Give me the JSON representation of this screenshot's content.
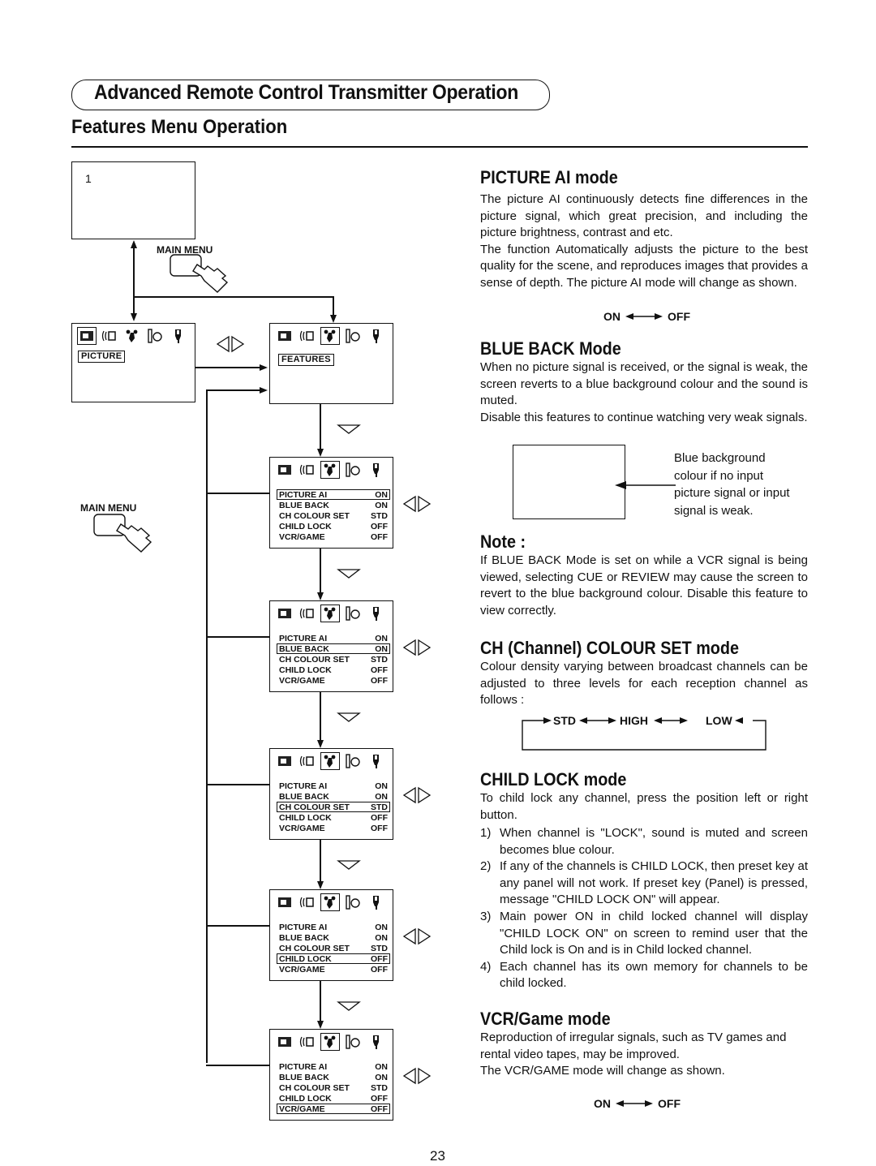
{
  "header": {
    "title": "Advanced Remote Control Transmitter Operation",
    "subtitle": "Features Menu Operation"
  },
  "diagram": {
    "channel_number": "1",
    "main_menu_label": "MAIN MENU",
    "main_menu_label_2": "MAIN MENU",
    "tabs": {
      "picture": "PICTURE",
      "features": "FEATURES"
    },
    "menu_icons": [
      "picture-icon",
      "sound-icon",
      "features-icon",
      "timer-icon",
      "setup-icon"
    ],
    "menu_items": [
      {
        "label": "PICTURE AI",
        "value": "ON"
      },
      {
        "label": "BLUE BACK",
        "value": "ON"
      },
      {
        "label": "CH COLOUR SET",
        "value": "STD"
      },
      {
        "label": "CHILD LOCK",
        "value": "OFF"
      },
      {
        "label": "VCR/GAME",
        "value": "OFF"
      }
    ],
    "menu_screens_highlight": [
      0,
      1,
      2,
      3,
      4
    ]
  },
  "sections": {
    "picture_ai": {
      "heading": "PICTURE AI mode",
      "body": [
        "The picture AI continuously detects fine differences in the picture signal, which great precision, and including the picture brightness, contrast and etc.",
        "The function Automatically adjusts the picture to the best quality for the scene, and reproduces images that provides a sense of depth. The picture AI mode will change as shown."
      ],
      "toggle_on": "ON",
      "toggle_off": "OFF"
    },
    "blue_back": {
      "heading": "BLUE BACK Mode",
      "body": [
        "When no picture signal is received, or the signal is weak, the screen reverts to a blue background colour and the sound is muted.",
        "Disable this features to continue watching very weak signals."
      ],
      "callout": [
        "Blue background",
        "colour if no input",
        "picture signal or input",
        "signal is weak."
      ]
    },
    "note": {
      "heading": "Note :",
      "body": "If BLUE BACK Mode is set on while a VCR signal is being viewed, selecting CUE or REVIEW may cause the screen to revert to the blue background colour. Disable this feature to view correctly."
    },
    "ch_colour_set": {
      "heading": "CH (Channel) COLOUR SET mode",
      "body": "Colour density varying between broadcast channels can be adjusted to three levels for each reception channel as follows :",
      "cycle": [
        "STD",
        "HIGH",
        "LOW"
      ]
    },
    "child_lock": {
      "heading": "CHILD LOCK mode",
      "intro": "To child lock any channel, press the position left or right button.",
      "items": [
        {
          "num": "1)",
          "text": "When channel is \"LOCK\", sound is muted and screen becomes blue colour."
        },
        {
          "num": "2)",
          "text": "If any of the channels is CHILD LOCK, then preset key at any panel will not work. If preset key (Panel) is pressed, message \"CHILD LOCK ON\" will appear."
        },
        {
          "num": "3)",
          "text": "Main power ON in child locked channel will display \"CHILD LOCK ON\" on screen to remind user that the Child lock is On and is in Child locked channel."
        },
        {
          "num": "4)",
          "text": "Each channel has its own memory for channels to be child locked."
        }
      ]
    },
    "vcr_game": {
      "heading": "VCR/Game mode",
      "body": [
        "Reproduction of irregular signals, such as TV games and rental video tapes, may be improved.",
        "The VCR/GAME mode will change as shown."
      ],
      "toggle_on": "ON",
      "toggle_off": "OFF"
    }
  },
  "footer": {
    "page_number": "23"
  }
}
